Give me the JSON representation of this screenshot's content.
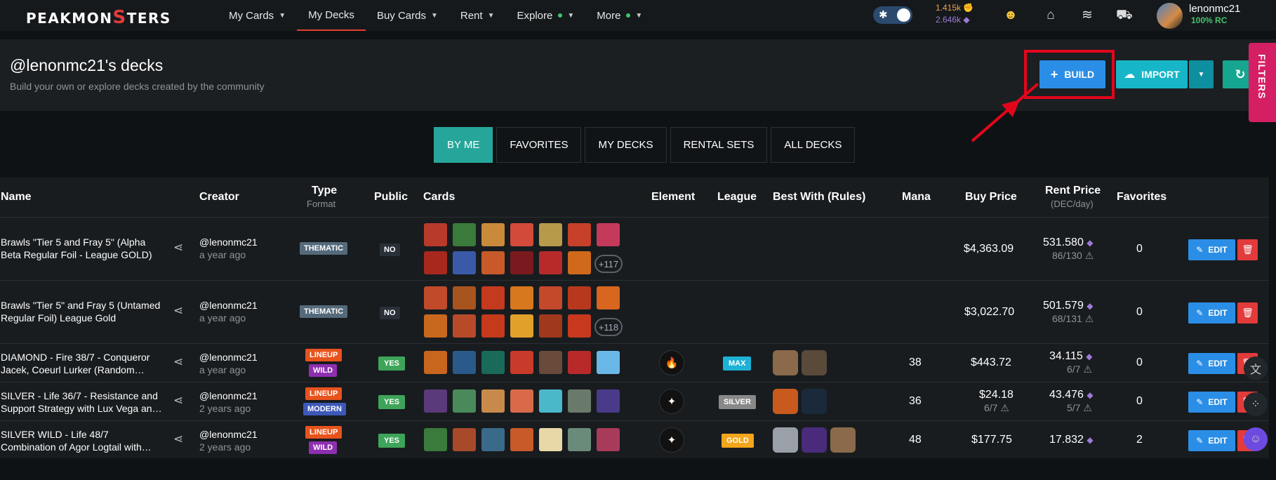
{
  "topbar": {
    "brand_a": "PEAKMON",
    "brand_s": "S",
    "brand_b": "TERS",
    "nav": [
      {
        "label": "My Cards",
        "chevron": true,
        "dot": false
      },
      {
        "label": "My Decks",
        "chevron": false,
        "dot": false,
        "active": true
      },
      {
        "label": "Buy Cards",
        "chevron": true,
        "dot": false
      },
      {
        "label": "Rent",
        "chevron": true,
        "dot": false
      },
      {
        "label": "Explore",
        "chevron": true,
        "dot": true
      },
      {
        "label": "More",
        "chevron": true,
        "dot": true
      }
    ],
    "balance_1": "1.415k",
    "balance_2": "2.646k",
    "username": "lenonmc21",
    "rc": "100% RC"
  },
  "header": {
    "title": "@lenonmc21's decks",
    "subtitle": "Build your own or explore decks created by the community",
    "build_label": "BUILD",
    "import_label": "IMPORT",
    "filters_label": "FILTERS"
  },
  "tabs": [
    "BY ME",
    "FAVORITES",
    "MY DECKS",
    "RENTAL SETS",
    "ALL DECKS"
  ],
  "columns": {
    "name": "Name",
    "creator": "Creator",
    "type": "Type",
    "type_sub": "Format",
    "public": "Public",
    "cards": "Cards",
    "element": "Element",
    "league": "League",
    "best_with": "Best With (Rules)",
    "mana": "Mana",
    "buy_price": "Buy Price",
    "rent_price": "Rent Price",
    "rent_sub": "(DEC/day)",
    "favorites": "Favorites"
  },
  "rows": [
    {
      "name_1": "Brawls \"Tier 5 and Fray 5\" (Alpha",
      "name_2": "Beta Regular Foil - League GOLD)",
      "creator": "@lenonmc21",
      "age": "a year ago",
      "type_1": "THEMATIC",
      "public": "NO",
      "more": "+117",
      "mana": "",
      "buy": "$4,363.09",
      "buy_sub": "",
      "rent": "531.580",
      "rent_sub": "86/130",
      "favorites": "0",
      "league": ""
    },
    {
      "name_1": "Brawls \"Tier 5\" and Fray 5 (Untamed",
      "name_2": "Regular Foil) League Gold",
      "creator": "@lenonmc21",
      "age": "a year ago",
      "type_1": "THEMATIC",
      "public": "NO",
      "more": "+118",
      "mana": "",
      "buy": "$3,022.70",
      "buy_sub": "",
      "rent": "501.579",
      "rent_sub": "68/131",
      "favorites": "0",
      "league": ""
    },
    {
      "name_1": "DIAMOND - Fire 38/7 - Conqueror",
      "name_2": "Jacek, Coeurl Lurker (Random…",
      "creator": "@lenonmc21",
      "age": "a year ago",
      "type_1": "LINEUP",
      "type_2": "WILD",
      "public": "YES",
      "more": "",
      "mana": "38",
      "buy": "$443.72",
      "buy_sub": "",
      "rent": "34.115",
      "rent_sub": "6/7",
      "favorites": "0",
      "league": "MAX"
    },
    {
      "name_1": "SILVER - Life 36/7 - Resistance and",
      "name_2": "Support Strategy with Lux Vega an…",
      "creator": "@lenonmc21",
      "age": "2 years ago",
      "type_1": "LINEUP",
      "type_2": "MODERN",
      "public": "YES",
      "more": "",
      "mana": "36",
      "buy": "$24.18",
      "buy_sub": "6/7",
      "rent": "43.476",
      "rent_sub": "5/7",
      "favorites": "0",
      "league": "SILVER"
    },
    {
      "name_1": "SILVER WILD - Life 48/7",
      "name_2": "Combination of Agor Logtail with…",
      "creator": "@lenonmc21",
      "age": "2 years ago",
      "type_1": "LINEUP",
      "type_2": "WILD",
      "public": "YES",
      "more": "",
      "mana": "48",
      "buy": "$177.75",
      "buy_sub": "",
      "rent": "17.832",
      "rent_sub": "",
      "favorites": "2",
      "league": "GOLD"
    }
  ],
  "edit_label": "EDIT",
  "colors": {
    "accent": "#2b8ee6",
    "teal": "#26a69a",
    "red": "#e23b3b",
    "brand_pink": "#d51f64"
  }
}
